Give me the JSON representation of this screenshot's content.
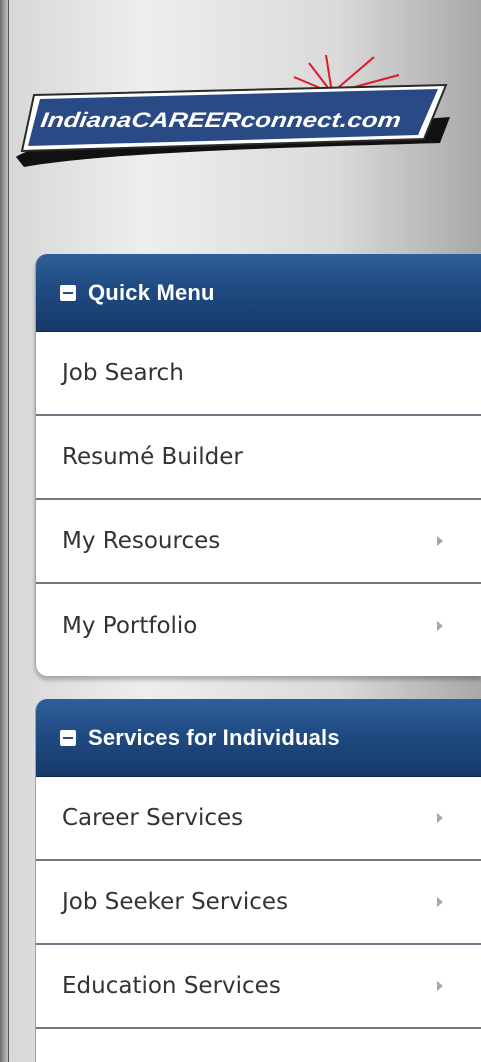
{
  "logo": {
    "text": "IndianaCAREERconnect.com"
  },
  "quick_menu": {
    "title": "Quick Menu",
    "items": [
      {
        "label": "Job Search",
        "submenu": false
      },
      {
        "label": "Resumé Builder",
        "submenu": false
      },
      {
        "label": "My Resources",
        "submenu": true
      },
      {
        "label": "My Portfolio",
        "submenu": true
      }
    ]
  },
  "services_menu": {
    "title": "Services for Individuals",
    "items": [
      {
        "label": "Career Services",
        "submenu": true
      },
      {
        "label": "Job Seeker Services",
        "submenu": true
      },
      {
        "label": "Education Services",
        "submenu": true
      }
    ]
  },
  "colors": {
    "header_blue": "#1f4b82",
    "item_text": "#333333",
    "divider": "#6e7a86",
    "logo_red": "#e0182a"
  },
  "icons": {
    "header_toggle": "collapse-square-icon",
    "submenu": "chevron-right-icon"
  }
}
